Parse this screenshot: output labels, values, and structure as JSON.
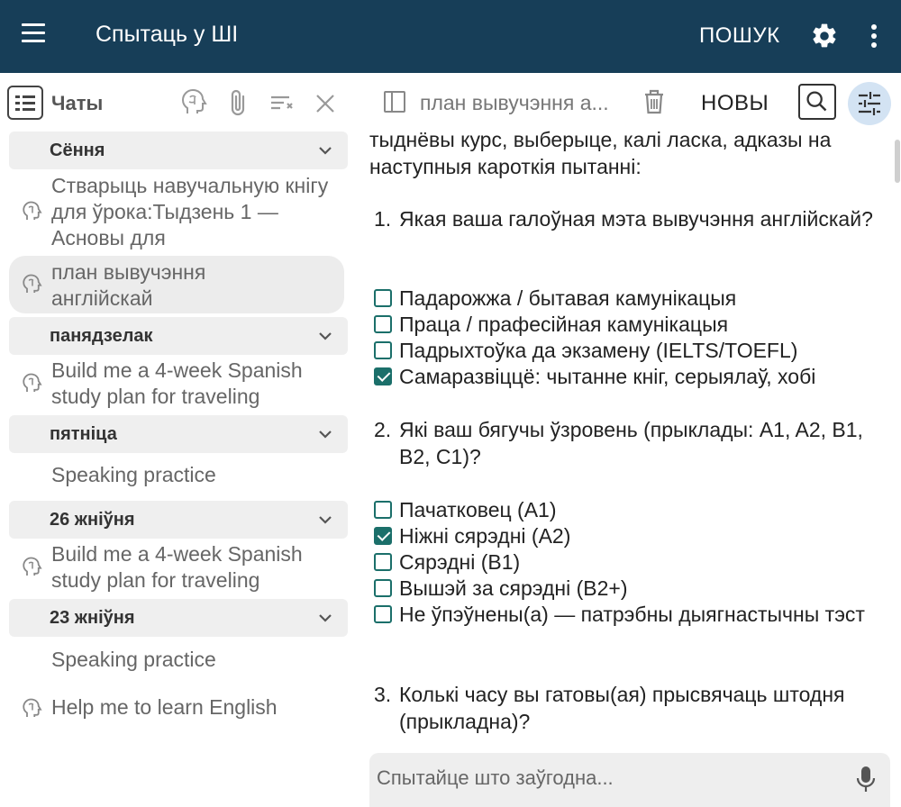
{
  "appbar": {
    "title": "Спытаць у ШІ",
    "search_label": "ПОШУК",
    "icons": [
      "menu-icon",
      "gear-icon",
      "more-vert-icon"
    ]
  },
  "sidebar": {
    "title": "Чаты",
    "header_icons": [
      "list-icon",
      "brain-icon",
      "attach-icon",
      "clear-list-icon",
      "close-icon"
    ],
    "sections": [
      {
        "label": "Сёння",
        "items": [
          {
            "text": "Стварыць навучальную кнігу для ўрока:Тыдзень 1 — Асновы для",
            "icon": "brain-icon",
            "selected": false
          },
          {
            "text": "план вывучэння англійскай",
            "icon": "brain-icon",
            "selected": true
          }
        ]
      },
      {
        "label": "панядзелак",
        "items": [
          {
            "text": "Build me a 4-week Spanish study plan for traveling",
            "icon": "brain-icon",
            "selected": false
          }
        ]
      },
      {
        "label": "пятніца",
        "items": [
          {
            "text": "Speaking practice",
            "icon": "",
            "selected": false
          }
        ]
      },
      {
        "label": "26 жніўня",
        "items": [
          {
            "text": "Build me a 4-week Spanish study plan for traveling",
            "icon": "brain-icon",
            "selected": false
          }
        ]
      },
      {
        "label": "23 жніўня",
        "items": [
          {
            "text": "Speaking practice",
            "icon": "",
            "selected": false
          },
          {
            "text": "Help me to learn English",
            "icon": "brain-icon",
            "selected": false
          }
        ]
      }
    ]
  },
  "chat": {
    "title": "план вывучэння а...",
    "new_label": "НОВЫ",
    "intro": "тыднёвы курс, выберыце, калі ласка, адказы на наступныя кароткія пытанні:",
    "questions": [
      {
        "num": "1.",
        "text": "Якая ваша галоўная мэта вывучэння англійскай?",
        "options": [
          {
            "text": "Падарожжа / бытавая камунікацыя",
            "checked": false
          },
          {
            "text": "Праца / прафесійная камунікацыя",
            "checked": false
          },
          {
            "text": "Падрыхтоўка да экзамену (IELTS/TOEFL)",
            "checked": false
          },
          {
            "text": "Самаразвіццё: чытанне кніг, серыялаў, хобі",
            "checked": true
          }
        ]
      },
      {
        "num": "2.",
        "text": "Які ваш бягучы ўзровень (прыклады: A1, A2, B1, B2, C1)?",
        "options": [
          {
            "text": "Пачатковец (A1)",
            "checked": false
          },
          {
            "text": "Ніжні сярэдні (A2)",
            "checked": true
          },
          {
            "text": "Сярэдні (B1)",
            "checked": false
          },
          {
            "text": "Вышэй за сярэдні (B2+)",
            "checked": false
          },
          {
            "text": "Не ўпэўнены(а) — патрэбны дыягнастычны тэст",
            "checked": false
          }
        ]
      },
      {
        "num": "3.",
        "text": "Колькі часу вы гатовы(ая) прысвячаць штодня (прыкладна)?",
        "options": []
      }
    ],
    "input_placeholder": "Спытайце што заўгодна...",
    "accent_color": "#1b6f6a",
    "appbar_color": "#173e58"
  }
}
